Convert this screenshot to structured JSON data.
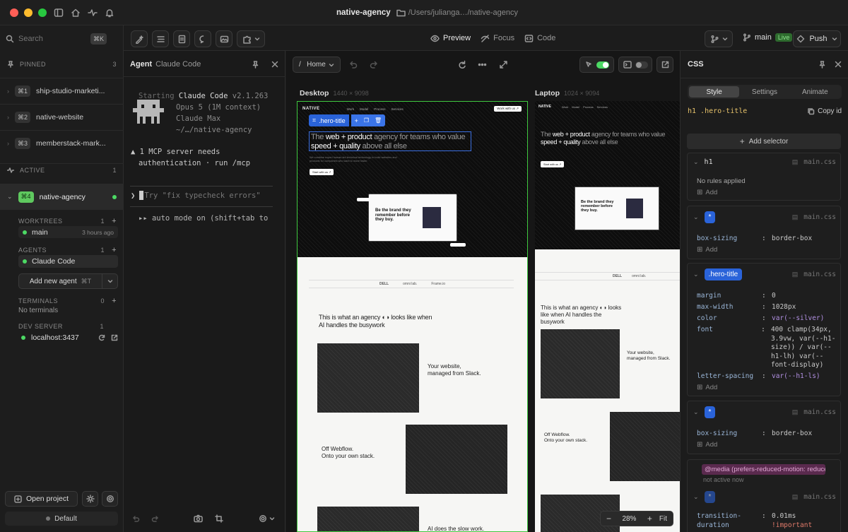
{
  "titlebar": {
    "title": "native-agency",
    "path": "/Users/julianga…/native-agency"
  },
  "search": {
    "placeholder": "Search",
    "shortcut": "⌘K"
  },
  "toolbar": {
    "tabs": [
      {
        "label": "Preview"
      },
      {
        "label": "Focus"
      },
      {
        "label": "Code"
      }
    ],
    "branch": "main",
    "live_badge": "Live",
    "push_label": "Push"
  },
  "sidebar": {
    "pinned_label": "PINNED",
    "pinned_count": "3",
    "projects": [
      {
        "key": "⌘1",
        "name": "ship-studio-marketi..."
      },
      {
        "key": "⌘2",
        "name": "native-website"
      },
      {
        "key": "⌘3",
        "name": "memberstack-mark..."
      }
    ],
    "active_label": "ACTIVE",
    "active_count": "1",
    "active_project": {
      "key": "⌘4",
      "name": "native-agency"
    },
    "worktrees_label": "WORKTREES",
    "worktrees_count": "1",
    "worktree": {
      "name": "main",
      "time": "3 hours ago"
    },
    "agents_label": "AGENTS",
    "agents_count": "1",
    "agent_item": "Claude Code",
    "add_agent": "Add new agent",
    "add_agent_kbd": "⌘T",
    "terminals_label": "TERMINALS",
    "terminals_count": "0",
    "no_terminals": "No terminals",
    "devserver_label": "DEV SERVER",
    "devserver_count": "1",
    "devserver_url": "localhost:3437",
    "open_project": "Open project",
    "default_label": "Default"
  },
  "agent": {
    "title": "Agent",
    "subtitle": "Claude Code",
    "starting": "Starting",
    "product": "Claude Code",
    "version": "v2.1.263",
    "model": "Opus 5 (1M context)",
    "plan": "Claude Max",
    "cwd": "~/…/native-agency",
    "mcp_line1": "▲ 1 MCP server needs",
    "mcp_line2": "authentication · run /mcp",
    "prompt_placeholder": "Try \"fix typecheck errors\"",
    "auto_mode": "▸▸ auto mode on (shift+tab to"
  },
  "preview": {
    "route": "/   Home",
    "desktop_label": "Desktop",
    "desktop_size": "1440 × 9098",
    "laptop_label": "Laptop",
    "laptop_size": "1024 × 9094",
    "hero_tag": ".hero-title",
    "site": {
      "logo": "NATIVE",
      "nav": [
        "Work",
        "Model",
        "Process",
        "Services"
      ],
      "cta": "Work with us ↗",
      "hero_pre": "The",
      "hero_mid1": "web + product",
      "hero_mid2": "agency for teams who value",
      "hero_mid3": "speed + quality",
      "hero_end": "above all else",
      "sub": "We combine expert human-led technical technology to build websites and products for companies who want to move faster.",
      "start_btn": "Start with us ↗",
      "card_heading": "Be the brand they remember before they buy.",
      "clients": [
        "DELL",
        "omni lab.",
        "Frame.io"
      ],
      "section1_a": "This is what an agency",
      "section1_b": "looks like when AI handles the busywork",
      "feat1_a": "Your website,",
      "feat1_b": "managed from Slack.",
      "feat2_a": "Off Webflow.",
      "feat2_b": "Onto your own stack.",
      "feat3": "AI does the slow work."
    },
    "zoom": "28%",
    "fit": "Fit"
  },
  "css_panel": {
    "title": "CSS",
    "tabs": [
      {
        "label": "Style"
      },
      {
        "label": "Settings"
      },
      {
        "label": "Animate"
      }
    ],
    "selector_path": "h1 .hero-title",
    "copy_id": "Copy id",
    "add_selector": "Add selector",
    "add": "Add",
    "file": "main.css",
    "h1_sel": "h1",
    "no_rules": "No rules applied",
    "star": "*",
    "box_sizing_k": "box-sizing",
    "box_sizing_v": "border-box",
    "hero_sel": ".hero-title",
    "rules": [
      {
        "k": "margin",
        "v": "0"
      },
      {
        "k": "max-width",
        "v": "1028px"
      },
      {
        "k": "color",
        "v": "var(--silver)"
      },
      {
        "k": "font",
        "v": "400 clamp(34px, 3.9vw, var(--h1-size)) / var(--h1-lh) var(--font-display)"
      },
      {
        "k": "letter-spacing",
        "v": "var(--h1-ls)"
      }
    ],
    "media_query": "@media (prefers-reduced-motion: reduce)",
    "not_active": "not active now",
    "transition_k": "transition-duration",
    "transition_v": "0.01ms",
    "important": "!important"
  }
}
